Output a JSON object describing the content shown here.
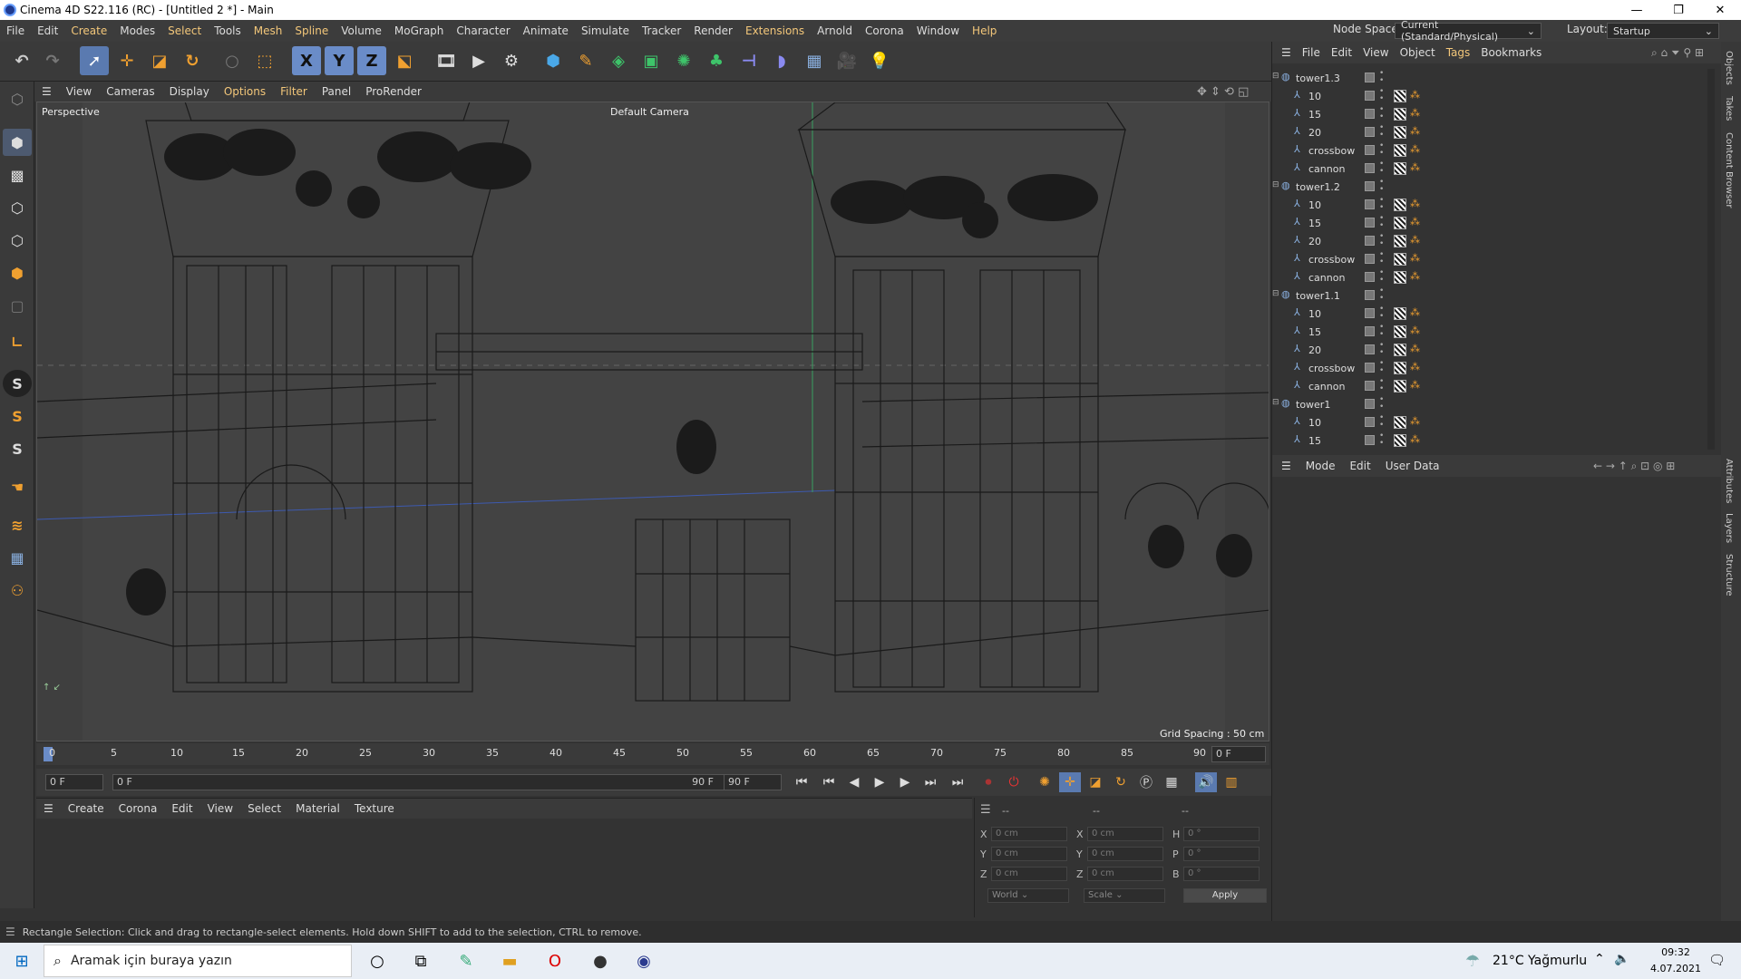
{
  "window": {
    "title": "Cinema 4D S22.116 (RC) - [Untitled 2 *] - Main",
    "min": "—",
    "max": "❐",
    "close": "✕"
  },
  "menubar": {
    "items": [
      "File",
      "Edit",
      "Create",
      "Modes",
      "Select",
      "Tools",
      "Mesh",
      "Spline",
      "Volume",
      "MoGraph",
      "Character",
      "Animate",
      "Simulate",
      "Tracker",
      "Render",
      "Extensions",
      "Arnold",
      "Corona",
      "Window",
      "Help"
    ]
  },
  "nodespace": {
    "label": "Node Space:",
    "value": "Current (Standard/Physical)"
  },
  "layout": {
    "label": "Layout:",
    "value": "Startup"
  },
  "toolbar": {
    "x": "X",
    "y": "Y",
    "z": "Z"
  },
  "viewport": {
    "menu": [
      "View",
      "Cameras",
      "Display",
      "Options",
      "Filter",
      "Panel",
      "ProRender"
    ],
    "name": "Perspective",
    "camera": "Default Camera",
    "grid": "Grid Spacing : 50 cm"
  },
  "timeline": {
    "ticks": [
      "0",
      "5",
      "10",
      "15",
      "20",
      "25",
      "30",
      "35",
      "40",
      "45",
      "50",
      "55",
      "60",
      "65",
      "70",
      "75",
      "80",
      "85",
      "90"
    ],
    "frame": "0 F"
  },
  "transport": {
    "start": "0 F",
    "current": "0 F",
    "end_bar": "90 F",
    "end": "90 F"
  },
  "material": {
    "menu": [
      "Create",
      "Corona",
      "Edit",
      "View",
      "Select",
      "Material",
      "Texture"
    ]
  },
  "coords": {
    "headers": [
      "--",
      "--",
      "--"
    ],
    "rows": [
      {
        "a": "X",
        "av": "0 cm",
        "b": "X",
        "bv": "0 cm",
        "c": "H",
        "cv": "0 °"
      },
      {
        "a": "Y",
        "av": "0 cm",
        "b": "Y",
        "bv": "0 cm",
        "c": "P",
        "cv": "0 °"
      },
      {
        "a": "Z",
        "av": "0 cm",
        "b": "Z",
        "bv": "0 cm",
        "c": "B",
        "cv": "0 °"
      }
    ],
    "world": "World",
    "scale": "Scale",
    "apply": "Apply"
  },
  "objects": {
    "menu": [
      "File",
      "Edit",
      "View",
      "Object",
      "Tags",
      "Bookmarks"
    ],
    "rows": [
      {
        "name": "tower1.3",
        "group": true
      },
      {
        "name": "10"
      },
      {
        "name": "15"
      },
      {
        "name": "20"
      },
      {
        "name": "crossbow"
      },
      {
        "name": "cannon"
      },
      {
        "name": "tower1.2",
        "group": true
      },
      {
        "name": "10"
      },
      {
        "name": "15"
      },
      {
        "name": "20"
      },
      {
        "name": "crossbow"
      },
      {
        "name": "cannon"
      },
      {
        "name": "tower1.1",
        "group": true
      },
      {
        "name": "10"
      },
      {
        "name": "15"
      },
      {
        "name": "20"
      },
      {
        "name": "crossbow"
      },
      {
        "name": "cannon"
      },
      {
        "name": "tower1",
        "group": true
      },
      {
        "name": "10"
      },
      {
        "name": "15"
      }
    ]
  },
  "attributes": {
    "menu": [
      "Mode",
      "Edit",
      "User Data"
    ]
  },
  "vtabs_top": [
    "Objects",
    "Takes",
    "Content Browser"
  ],
  "vtabs_bottom": [
    "Attributes",
    "Layers",
    "Structure"
  ],
  "status": "Rectangle Selection: Click and drag to rectangle-select elements. Hold down SHIFT to add to the selection, CTRL to remove.",
  "taskbar": {
    "search": "Aramak için buraya yazın",
    "weather": "21°C  Yağmurlu",
    "time": "09:32",
    "date": "4.07.2021"
  },
  "colors": {
    "accent": "#f3c77a",
    "selected": "#5a7ab0"
  }
}
